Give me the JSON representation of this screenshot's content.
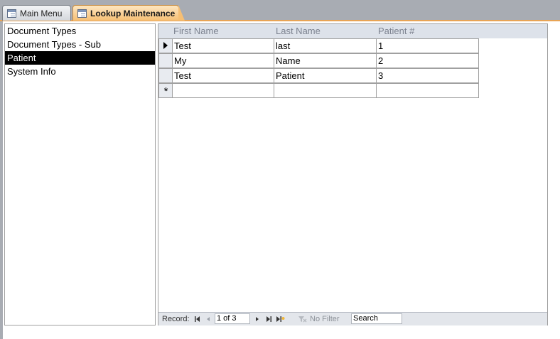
{
  "tabs": [
    {
      "label": "Main Menu",
      "active": false
    },
    {
      "label": "Lookup Maintenance",
      "active": true
    }
  ],
  "listbox": {
    "items": [
      {
        "label": "Document Types",
        "selected": false
      },
      {
        "label": "Document Types - Sub",
        "selected": false
      },
      {
        "label": "Patient",
        "selected": true
      },
      {
        "label": "System Info",
        "selected": false
      }
    ]
  },
  "datasheet": {
    "columns": [
      "First Name",
      "Last Name",
      "Patient #"
    ],
    "rows": [
      [
        "Test",
        "last",
        "1"
      ],
      [
        "My",
        "Name",
        "2"
      ],
      [
        "Test",
        "Patient",
        "3"
      ]
    ],
    "new_row_marker": "*"
  },
  "navigation": {
    "record_label": "Record:",
    "record_position": "1 of 3",
    "filter_label": "No Filter",
    "search_placeholder": "Search"
  },
  "colors": {
    "active_tab": "#f6bf74",
    "selected_item": "#000000",
    "header_bg": "#dde2ea"
  }
}
